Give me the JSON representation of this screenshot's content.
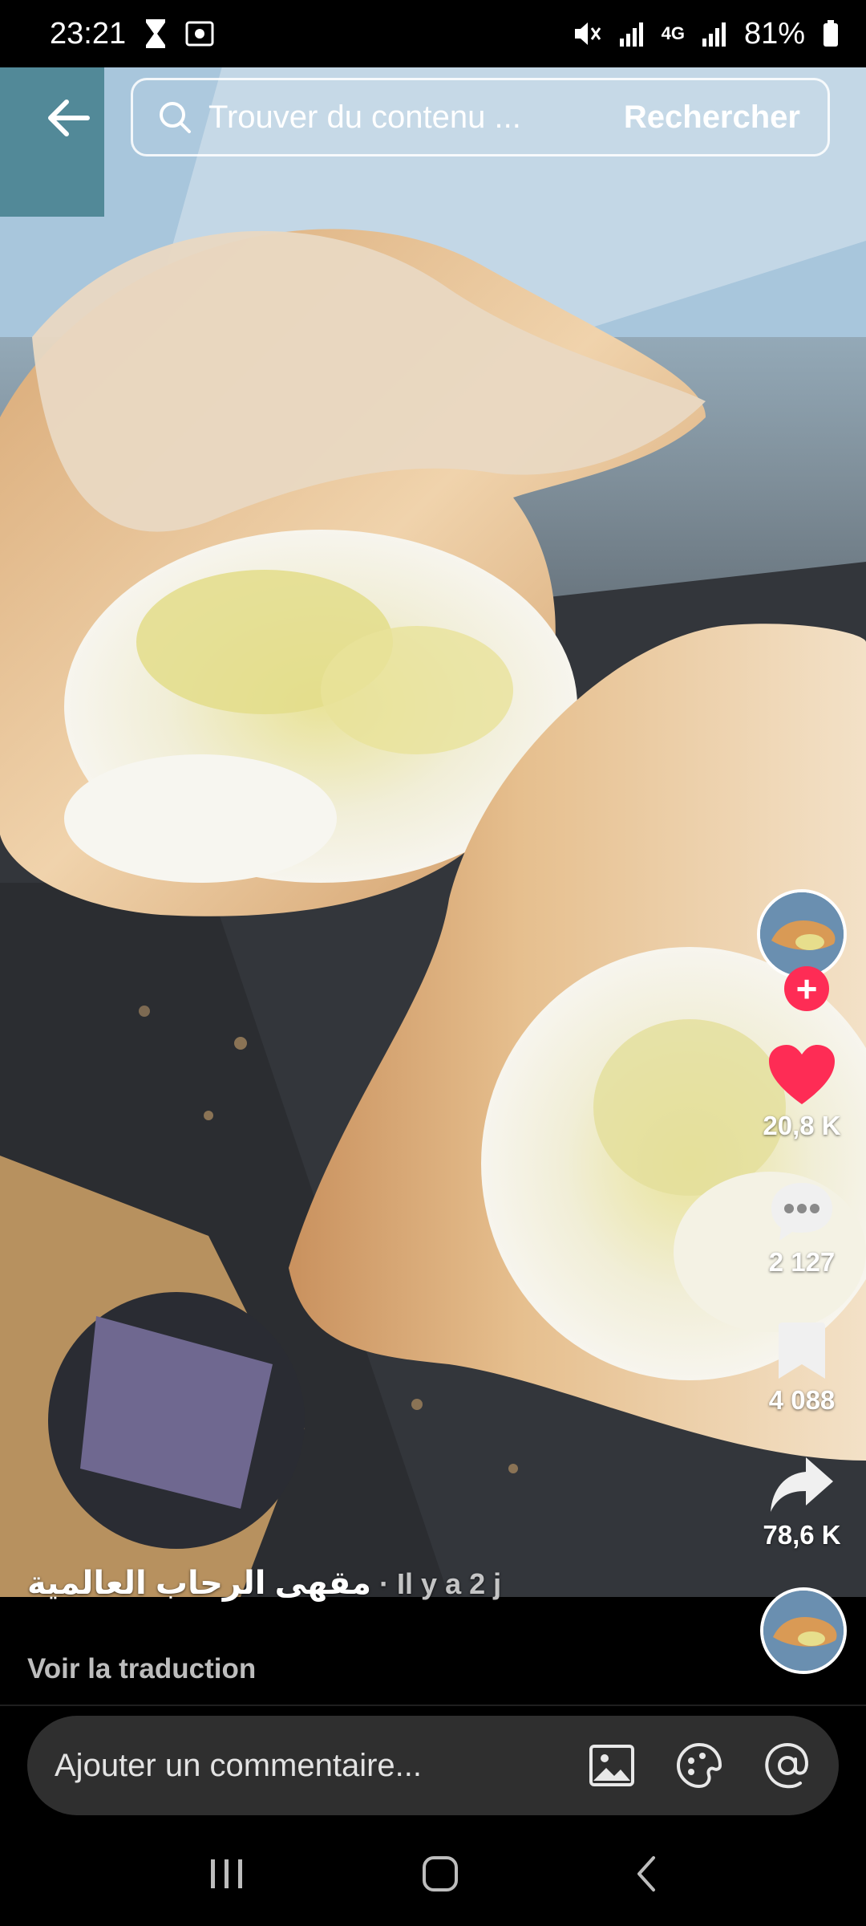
{
  "status_bar": {
    "time": "23:21",
    "battery": "81%",
    "network": "4G"
  },
  "search": {
    "placeholder": "Trouver du contenu ...",
    "button": "Rechercher"
  },
  "video": {
    "author": "مقهى الرحاب العالمية",
    "posted": "· Il y a 2 j",
    "translate": "Voir la traduction"
  },
  "actions": {
    "likes": "20,8 K",
    "comments": "2 127",
    "saves": "4 088",
    "shares": "78,6 K"
  },
  "comment_bar": {
    "placeholder": "Ajouter un commentaire..."
  },
  "colors": {
    "like": "#fe2c55",
    "follow": "#fe2c55",
    "comment_bar_bg": "#2f2f2f"
  },
  "icons": [
    "back-arrow-icon",
    "search-icon",
    "heart-icon",
    "comment-icon",
    "bookmark-icon",
    "share-icon",
    "image-icon",
    "emoji-icon",
    "mention-icon",
    "recents-icon",
    "home-icon",
    "nav-back-icon"
  ]
}
